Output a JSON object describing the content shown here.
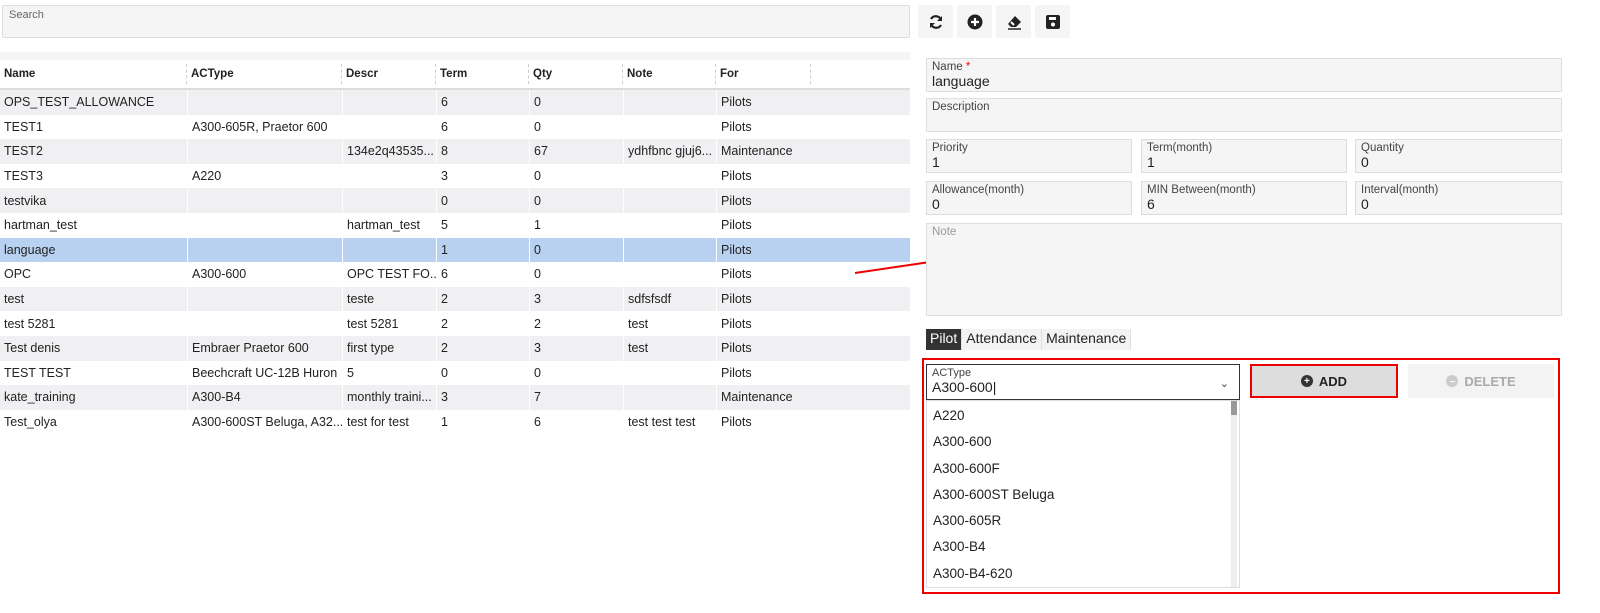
{
  "search": {
    "placeholder": "Search"
  },
  "toolbar": [
    "refresh-icon",
    "add-icon",
    "eraser-icon",
    "save-icon"
  ],
  "grid": {
    "columns": [
      "Name",
      "ACType",
      "Descr",
      "Term",
      "Qty",
      "Note",
      "For"
    ],
    "rows": [
      [
        "OPS_TEST_ALLOWANCE",
        "",
        "",
        "6",
        "0",
        "",
        "Pilots"
      ],
      [
        "TEST1",
        "A300-605R, Praetor 600",
        "",
        "6",
        "0",
        "",
        "Pilots"
      ],
      [
        "TEST2",
        "",
        "134e2q43535...",
        "8",
        "67",
        "ydhfbnc gjuj6...",
        "Maintenance"
      ],
      [
        "TEST3",
        "A220",
        "",
        "3",
        "0",
        "",
        "Pilots"
      ],
      [
        "testvika",
        "",
        "",
        "0",
        "0",
        "",
        "Pilots"
      ],
      [
        "hartman_test",
        "",
        "hartman_test",
        "5",
        "1",
        "",
        "Pilots"
      ],
      [
        "language",
        "",
        "",
        "1",
        "0",
        "",
        "Pilots"
      ],
      [
        "OPC",
        "A300-600",
        "OPC TEST FO...",
        "6",
        "0",
        "",
        "Pilots"
      ],
      [
        "test",
        "",
        "teste",
        "2",
        "3",
        "sdfsfsdf",
        "Pilots"
      ],
      [
        "test 5281",
        "",
        "test 5281",
        "2",
        "2",
        "test",
        "Pilots"
      ],
      [
        "Test denis",
        "Embraer Praetor 600",
        "first type",
        "2",
        "3",
        "test",
        "Pilots"
      ],
      [
        "TEST TEST",
        "Beechcraft UC-12B Huron",
        "5",
        "0",
        "0",
        "",
        "Pilots"
      ],
      [
        "kate_training",
        "A300-B4",
        "monthly traini...",
        "3",
        "7",
        "",
        "Maintenance"
      ],
      [
        "Test_olya",
        "A300-600ST Beluga, A32...",
        "test for test",
        "1",
        "6",
        "test test test",
        "Pilots"
      ]
    ],
    "selected_index": 6
  },
  "form": {
    "name": {
      "label": "Name",
      "required": "*",
      "value": "language"
    },
    "description": {
      "label": "Description",
      "value": ""
    },
    "priority": {
      "label": "Priority",
      "value": "1"
    },
    "term": {
      "label": "Term(month)",
      "value": "1"
    },
    "quantity": {
      "label": "Quantity",
      "value": "0"
    },
    "allowance": {
      "label": "Allowance(month)",
      "value": "0"
    },
    "min_between": {
      "label": "MIN Between(month)",
      "value": "6"
    },
    "interval": {
      "label": "Interval(month)",
      "value": "0"
    },
    "note": {
      "placeholder": "Note"
    }
  },
  "tabs": [
    "Pilot",
    "Attendance",
    "Maintenance"
  ],
  "actype": {
    "label": "ACType",
    "value": "A300-600",
    "options": [
      "A220",
      "A300-600",
      "A300-600F",
      "A300-600ST Beluga",
      "A300-605R",
      "A300-B4",
      "A300-B4-620"
    ]
  },
  "buttons": {
    "add": "ADD",
    "delete": "DELETE"
  },
  "colors": {
    "highlight": "#e00000",
    "selected_row": "#b9d1f0"
  }
}
